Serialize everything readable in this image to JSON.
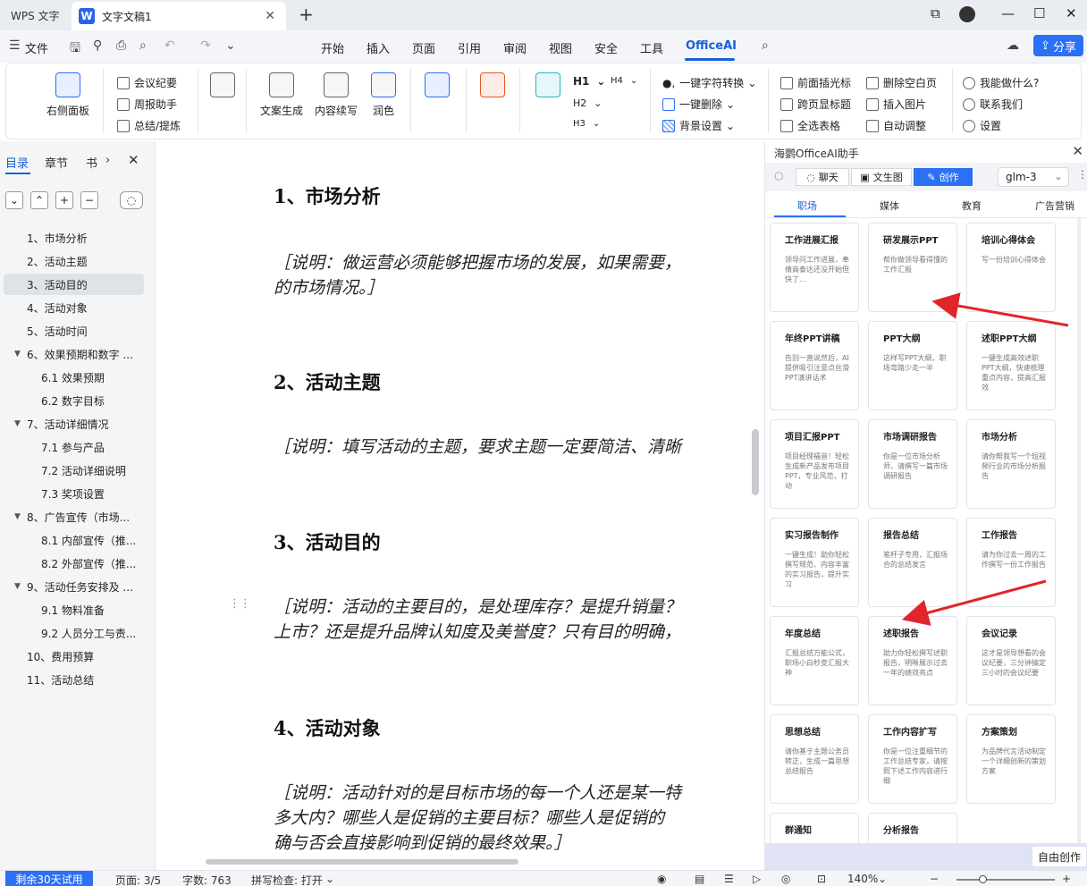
{
  "titlebar": {
    "app_tab": "WPS 文字",
    "doc_tab": "文字文稿1",
    "doc_icon": "W"
  },
  "menu": {
    "file": "文件",
    "tabs": [
      "开始",
      "插入",
      "页面",
      "引用",
      "审阅",
      "视图",
      "安全",
      "工具",
      "OfficeAI"
    ],
    "share": "分享"
  },
  "ribbon": {
    "right_panel": "右侧面板",
    "meeting": "会议纪要",
    "weekly": "周报助手",
    "summary": "总结/提炼",
    "copy_gen": "文案生成",
    "continue": "内容续写",
    "polish": "润色",
    "h1": "H1",
    "h2": "H2",
    "h3": "H3",
    "h4": "H4",
    "char_convert": "一键字符转换",
    "one_delete": "一键删除",
    "bg_setting": "背景设置",
    "insert_cursor": "前面插光标",
    "cross_page": "跨页显标题",
    "select_table": "全选表格",
    "delete_blank": "删除空白页",
    "insert_image": "插入图片",
    "auto_adjust": "自动调整",
    "what_can": "我能做什么?",
    "contact": "联系我们",
    "settings": "设置"
  },
  "leftpane": {
    "tabs": [
      "目录",
      "章节",
      "书"
    ],
    "toc": [
      {
        "label": "1、市场分析",
        "level": 1
      },
      {
        "label": "2、活动主题",
        "level": 1
      },
      {
        "label": "3、活动目的",
        "level": 1,
        "active": true
      },
      {
        "label": "4、活动对象",
        "level": 1
      },
      {
        "label": "5、活动时间",
        "level": 1
      },
      {
        "label": "6、效果预期和数字 ...",
        "level": 1,
        "expanded": true
      },
      {
        "label": "6.1 效果预期",
        "level": 2
      },
      {
        "label": "6.2 数字目标",
        "level": 2
      },
      {
        "label": "7、活动详细情况",
        "level": 1,
        "expanded": true
      },
      {
        "label": "7.1 参与产品",
        "level": 2
      },
      {
        "label": "7.2 活动详细说明",
        "level": 2
      },
      {
        "label": "7.3 奖项设置",
        "level": 2
      },
      {
        "label": "8、广告宣传（市场...",
        "level": 1,
        "expanded": true
      },
      {
        "label": "8.1 内部宣传（推...",
        "level": 2
      },
      {
        "label": "8.2 外部宣传（推...",
        "level": 2
      },
      {
        "label": "9、活动任务安排及 ...",
        "level": 1,
        "expanded": true
      },
      {
        "label": "9.1 物料准备",
        "level": 2
      },
      {
        "label": "9.2 人员分工与责...",
        "level": 2
      },
      {
        "label": "10、费用预算",
        "level": 1
      },
      {
        "label": "11、活动总结",
        "level": 1
      }
    ]
  },
  "document": {
    "sections": [
      {
        "heading": "1、市场分析",
        "lines": [
          "［说明：做运营必须能够把握市场的发展，如果需要，",
          "的市场情况。］"
        ]
      },
      {
        "heading": "2、活动主题",
        "lines": [
          "［说明：填写活动的主题，要求主题一定要简洁、清晰"
        ]
      },
      {
        "heading": "3、活动目的",
        "lines": [
          "［说明：活动的主要目的，是处理库存？是提升销量？",
          "上市？还是提升品牌认知度及美誉度？只有目的明确，"
        ]
      },
      {
        "heading": "4、活动对象",
        "lines": [
          "［说明：活动针对的是目标市场的每一个人还是某一特",
          "多大内？哪些人是促销的主要目标？哪些人是促销的",
          "确与否会直接影响到促销的最终效果。］"
        ]
      }
    ]
  },
  "rightpanel": {
    "title": "海鹦OfficeAI助手",
    "modes": [
      "聊天",
      "文生图",
      "创作"
    ],
    "model": "glm-3",
    "categories": [
      "职场",
      "媒体",
      "教育",
      "广告营销"
    ],
    "cards": [
      {
        "title": "工作进展汇报",
        "desc": "领导问工作进展，奉倩商泰达还没开始但快了..."
      },
      {
        "title": "研发展示PPT",
        "desc": "帮你做领导看得懂的工作汇报"
      },
      {
        "title": "培训心得体会",
        "desc": "写一份培训心得体会"
      },
      {
        "title": "年终PPT讲稿",
        "desc": "告别一直说然后，AI提供吸引注意点丝滑PPT演讲话术"
      },
      {
        "title": "PPT大纲",
        "desc": "这样写PPT大纲，职场弯路少走一半"
      },
      {
        "title": "述职PPT大纲",
        "desc": "一键生成高效述职PPT大纲，快速梳理重点内容，提高汇报效"
      },
      {
        "title": "项目汇报PPT",
        "desc": "项目经理福音！轻松生成新产品发布项目PPT，专业风范，打动"
      },
      {
        "title": "市场调研报告",
        "desc": "你是一位市场分析师，请撰写一篇市场调研报告"
      },
      {
        "title": "市场分析",
        "desc": "请你帮我写一个短视频行业的市场分析报告"
      },
      {
        "title": "实习报告制作",
        "desc": "一键生成！助你轻松撰写规范、内容丰富的实习报告，提升实习"
      },
      {
        "title": "报告总结",
        "desc": "笔杆子专用，汇报场合的总结发言"
      },
      {
        "title": "工作报告",
        "desc": "请为你过去一周的工作撰写一份工作报告"
      },
      {
        "title": "年度总结",
        "desc": "汇报总结万能公式，职场小白秒变汇报大神"
      },
      {
        "title": "述职报告",
        "desc": "助力你轻松撰写述职报告，明晰展示过去一年的绩效亮点"
      },
      {
        "title": "会议记录",
        "desc": "这才是领导想看的会议纪要，三分钟搞定三小时的会议纪要"
      },
      {
        "title": "思想总结",
        "desc": "请你基于主题公务员转正，生成一篇思想总结报告"
      },
      {
        "title": "工作内容扩写",
        "desc": "你是一位注重细节的工作总结专家，请按照下述工作内容进行细"
      },
      {
        "title": "方案策划",
        "desc": "为品牌代言活动制定一个详细创新的策划方案"
      },
      {
        "title": "群通知",
        "desc": ""
      },
      {
        "title": "分析报告",
        "desc": ""
      }
    ],
    "free_create": "自由创作"
  },
  "statusbar": {
    "trial": "剩余30天试用",
    "page": "页面: 3/5",
    "words": "字数: 763",
    "spell": "拼写检查: 打开",
    "zoom": "140%"
  },
  "colors": {
    "accent": "#2b70f5",
    "annotation_arrow": "#e0262b"
  }
}
